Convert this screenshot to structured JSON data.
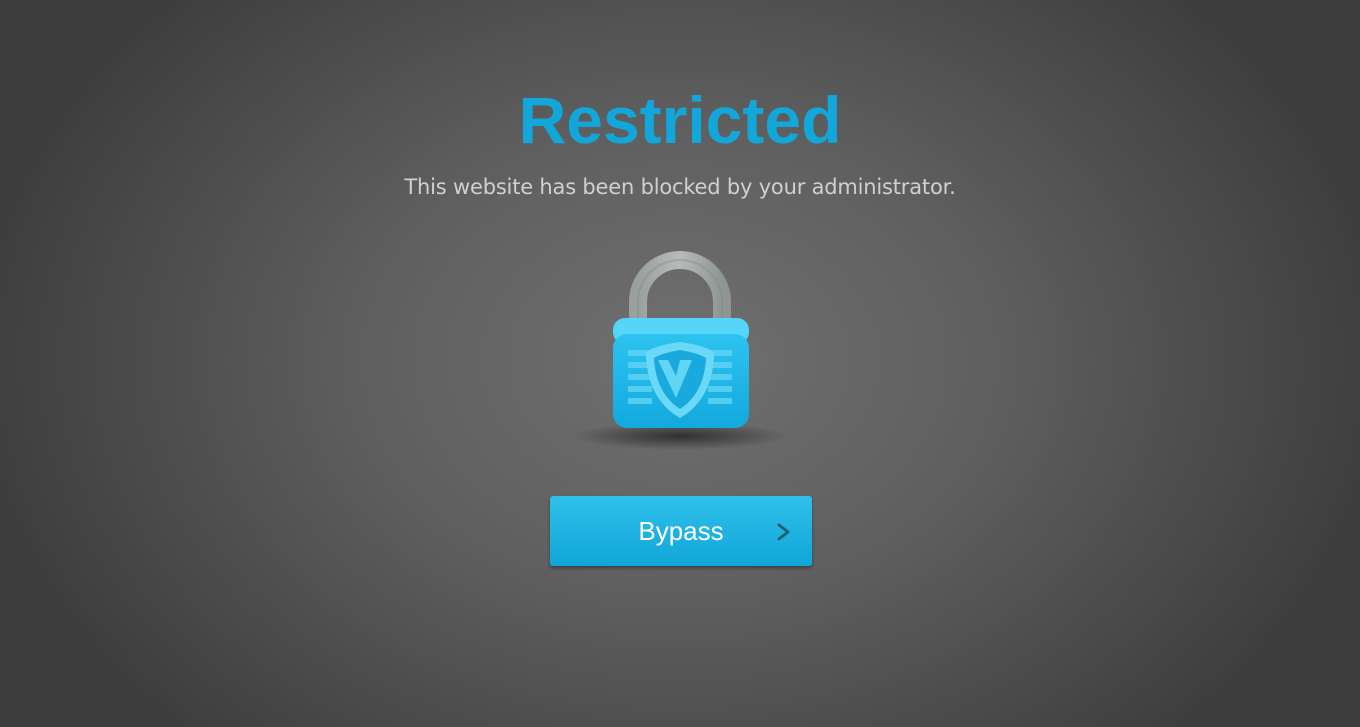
{
  "page": {
    "title": "Restricted",
    "message": "This website has been blocked by your administrator.",
    "bypass_label": "Bypass"
  },
  "icons": {
    "lock": "padlock-shield-icon",
    "bypass_arrow": "chevron-right-icon"
  },
  "colors": {
    "accent": "#12a7da",
    "message_text": "#d0d0d0",
    "button_text": "#ffffff",
    "shackle": "#a2a7a6",
    "lock_body": "#1eb5e6"
  }
}
